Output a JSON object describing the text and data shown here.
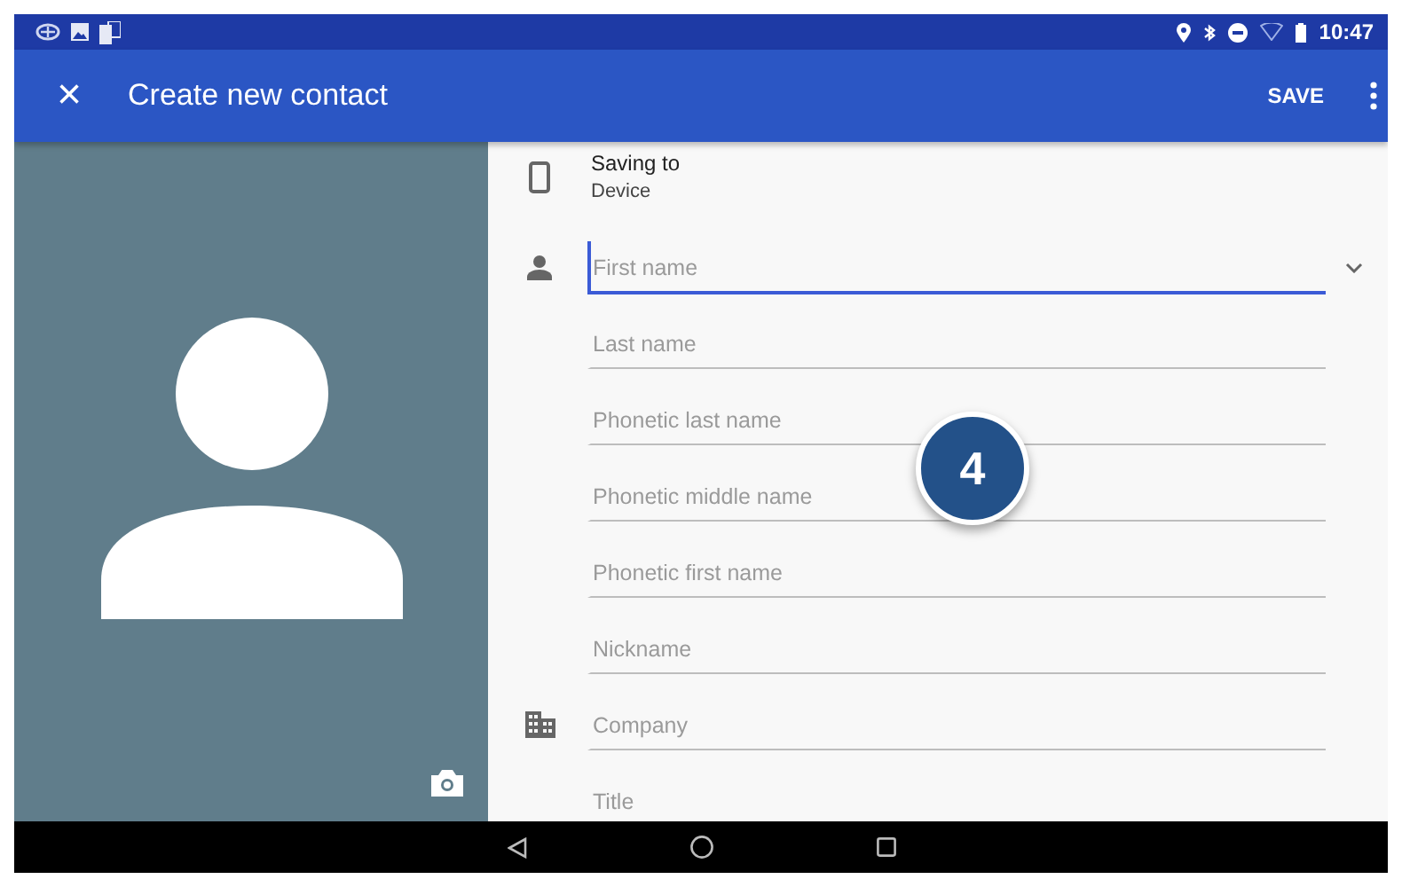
{
  "status_bar": {
    "time": "10:47"
  },
  "toolbar": {
    "close": "×",
    "title": "Create new contact",
    "save": "SAVE"
  },
  "saving_to": {
    "label": "Saving to",
    "account": "Device"
  },
  "fields": [
    {
      "placeholder": "First name",
      "focused": true,
      "kind": "name",
      "expandable": true
    },
    {
      "placeholder": "Last name",
      "focused": false,
      "kind": "text",
      "expandable": false
    },
    {
      "placeholder": "Phonetic last name",
      "focused": false,
      "kind": "text",
      "expandable": false
    },
    {
      "placeholder": "Phonetic middle name",
      "focused": false,
      "kind": "text",
      "expandable": false
    },
    {
      "placeholder": "Phonetic first name",
      "focused": false,
      "kind": "text",
      "expandable": false
    },
    {
      "placeholder": "Nickname",
      "focused": false,
      "kind": "text",
      "expandable": false
    },
    {
      "placeholder": "Company",
      "focused": false,
      "kind": "organization",
      "expandable": false
    },
    {
      "placeholder": "Title",
      "focused": false,
      "kind": "text",
      "expandable": false
    }
  ],
  "callout": {
    "number": "4"
  }
}
